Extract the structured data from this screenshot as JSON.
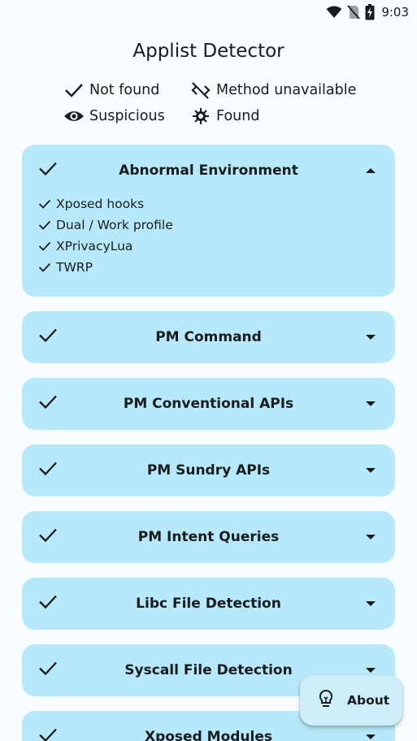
{
  "status_bar": {
    "time": "9:03",
    "icons": [
      "wifi-icon",
      "sim-off-icon",
      "battery-charging-icon"
    ]
  },
  "app": {
    "title": "Applist Detector"
  },
  "legend": {
    "not_found": "Not found",
    "method_unavailable": "Method unavailable",
    "suspicious": "Suspicious",
    "found": "Found"
  },
  "cards": [
    {
      "title": "Abnormal Environment",
      "status_icon": "check-icon",
      "expanded": true,
      "details": [
        "Xposed hooks",
        "Dual / Work profile",
        "XPrivacyLua",
        "TWRP"
      ]
    },
    {
      "title": "PM Command",
      "status_icon": "check-icon",
      "expanded": false
    },
    {
      "title": "PM Conventional APIs",
      "status_icon": "check-icon",
      "expanded": false
    },
    {
      "title": "PM Sundry APIs",
      "status_icon": "check-icon",
      "expanded": false
    },
    {
      "title": "PM Intent Queries",
      "status_icon": "check-icon",
      "expanded": false
    },
    {
      "title": "Libc File Detection",
      "status_icon": "check-icon",
      "expanded": false
    },
    {
      "title": "Syscall File Detection",
      "status_icon": "check-icon",
      "expanded": false
    },
    {
      "title": "Xposed Modules",
      "status_icon": "check-icon",
      "expanded": false
    }
  ],
  "fab": {
    "label": "About",
    "icon": "lightbulb-icon"
  },
  "colors": {
    "background": "#f8fdff",
    "card": "#b8e9fa",
    "fab": "#cdeef9",
    "text": "#171c1f"
  }
}
